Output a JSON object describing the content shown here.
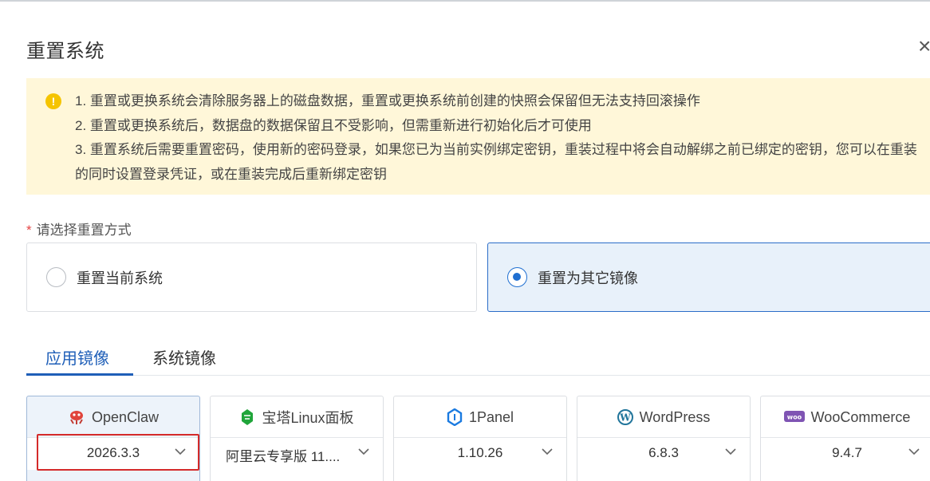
{
  "dialog": {
    "title": "重置系统",
    "close": "×"
  },
  "notice": {
    "icon": "warning-icon",
    "lines": [
      "1. 重置或更换系统会清除服务器上的磁盘数据，重置或更换系统前创建的快照会保留但无法支持回滚操作",
      "2. 重置或更换系统后，数据盘的数据保留且不受影响，但需重新进行初始化后才可使用",
      "3. 重置系统后需要重置密码，使用新的密码登录，如果您已为当前实例绑定密钥，重装过程中将会自动解绑之前已绑定的密钥，您可以在重装的同时设置登录凭证，或在重装完成后重新绑定密钥"
    ]
  },
  "reset_mode": {
    "required_mark": "*",
    "label": "请选择重置方式",
    "options": [
      {
        "label": "重置当前系统",
        "checked": false
      },
      {
        "label": "重置为其它镜像",
        "checked": true
      }
    ]
  },
  "tabs": [
    {
      "label": "应用镜像",
      "active": true
    },
    {
      "label": "系统镜像",
      "active": false
    }
  ],
  "images": [
    {
      "name": "OpenClaw",
      "icon": "openclaw-icon",
      "version": "2026.3.3",
      "selected": true
    },
    {
      "name": "宝塔Linux面板",
      "icon": "baota-icon",
      "version": "阿里云专享版 11....",
      "selected": false
    },
    {
      "name": "1Panel",
      "icon": "1panel-icon",
      "version": "1.10.26",
      "selected": false
    },
    {
      "name": "WordPress",
      "icon": "wordpress-icon",
      "version": "6.8.3",
      "selected": false
    },
    {
      "name": "WooCommerce",
      "icon": "woocommerce-icon",
      "version": "9.4.7",
      "selected": false
    }
  ],
  "colors": {
    "accent": "#1f5fb8",
    "notice_bg": "#fff7d9",
    "highlight_box": "#d42a2a"
  }
}
